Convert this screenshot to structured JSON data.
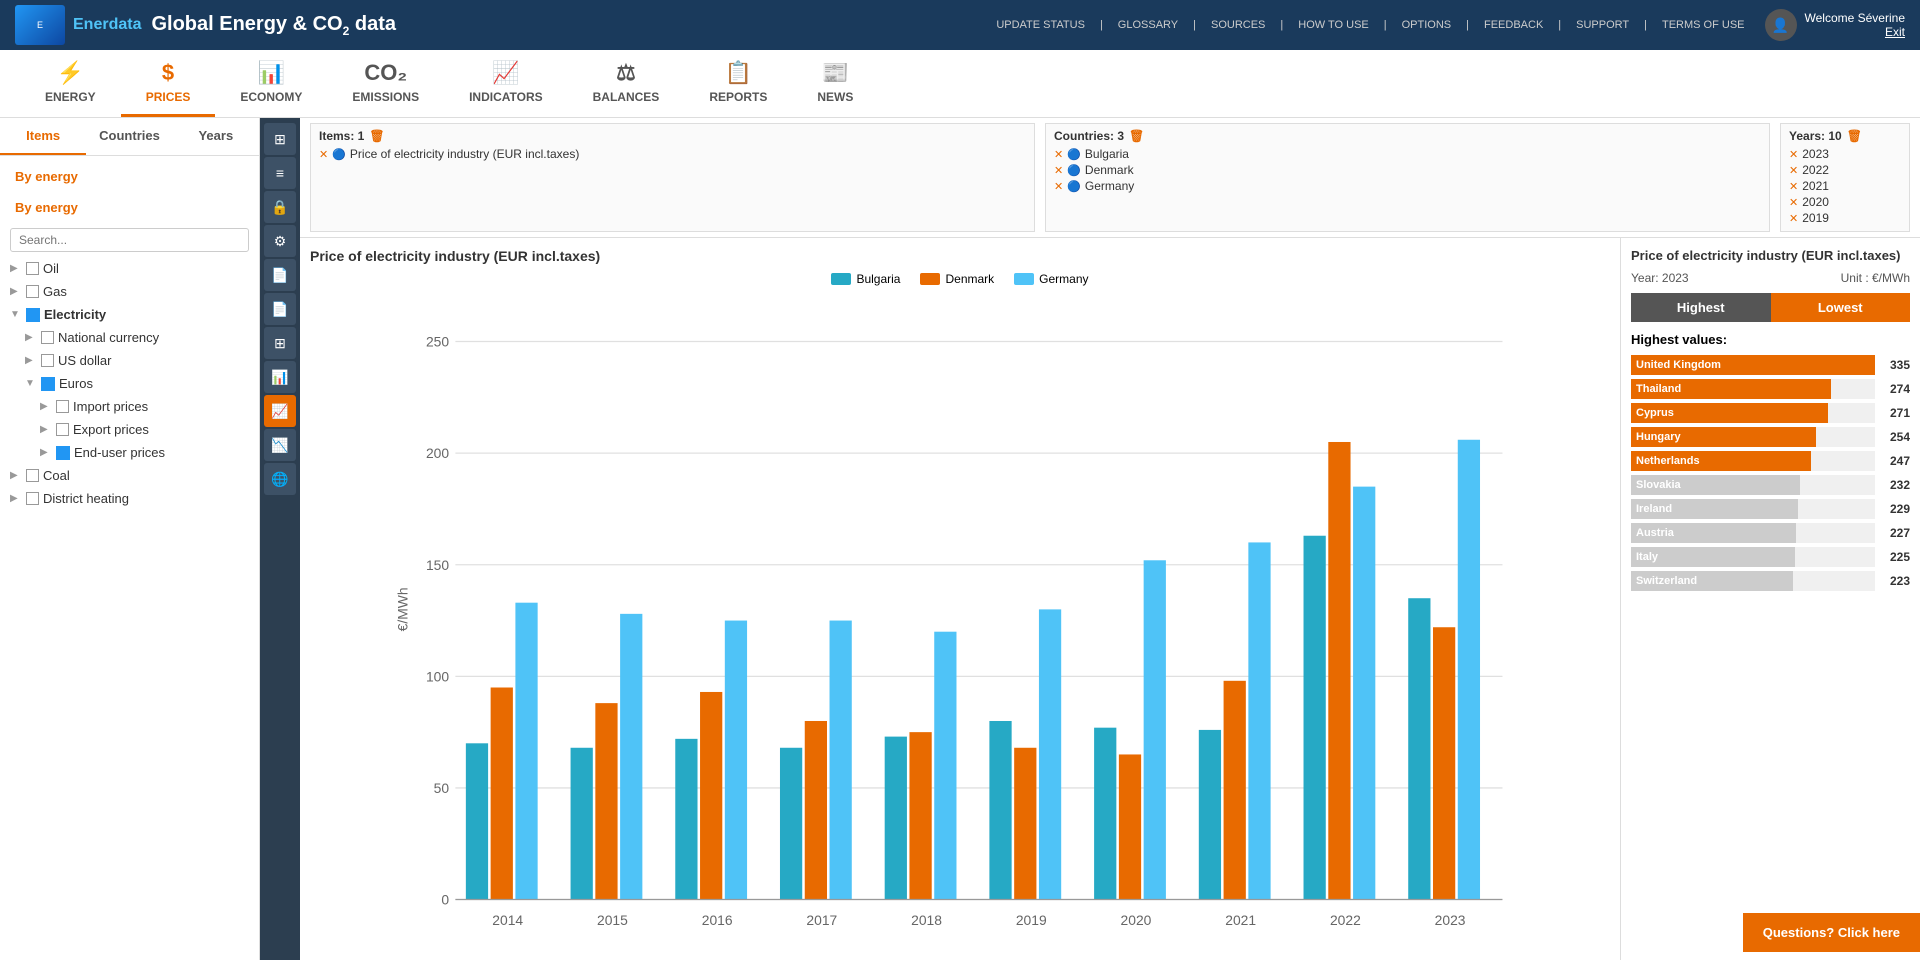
{
  "header": {
    "logo_text": "Enerdata",
    "title": "Global Energy & CO",
    "title_sub": "2",
    "title_suffix": " data",
    "nav_items": [
      "UPDATE STATUS",
      "GLOSSARY",
      "SOURCES",
      "HOW TO USE",
      "OPTIONS",
      "FEEDBACK",
      "SUPPORT",
      "TERMS OF USE"
    ],
    "user_name": "Welcome Séverine",
    "user_action": "Exit"
  },
  "top_nav": {
    "items": [
      {
        "id": "energy",
        "label": "ENERGY",
        "icon": "⚡"
      },
      {
        "id": "prices",
        "label": "PRICES",
        "icon": "$",
        "active": true
      },
      {
        "id": "economy",
        "label": "ECONOMY",
        "icon": "📊"
      },
      {
        "id": "emissions",
        "label": "EMISSIONS",
        "icon": "CO₂"
      },
      {
        "id": "indicators",
        "label": "INDICATORS",
        "icon": "📈"
      },
      {
        "id": "balances",
        "label": "BALANCES",
        "icon": "⚖"
      },
      {
        "id": "reports",
        "label": "REPORTS",
        "icon": "📋"
      },
      {
        "id": "news",
        "label": "NEWS",
        "icon": "📰"
      }
    ]
  },
  "sidebar": {
    "tabs": [
      "Items",
      "Countries",
      "Years"
    ],
    "active_tab": "Items",
    "section_label1": "By energy",
    "section_label2": "By energy",
    "tree": [
      {
        "id": "oil",
        "label": "Oil",
        "level": 0,
        "type": "checkbox"
      },
      {
        "id": "gas",
        "label": "Gas",
        "level": 0,
        "type": "checkbox"
      },
      {
        "id": "electricity",
        "label": "Electricity",
        "level": 0,
        "type": "icon",
        "expanded": true,
        "selected": true
      },
      {
        "id": "national_currency",
        "label": "National currency",
        "level": 1,
        "type": "checkbox"
      },
      {
        "id": "us_dollar",
        "label": "US dollar",
        "level": 1,
        "type": "checkbox"
      },
      {
        "id": "euros",
        "label": "Euros",
        "level": 1,
        "type": "icon",
        "expanded": true
      },
      {
        "id": "import_prices",
        "label": "Import prices",
        "level": 2,
        "type": "checkbox"
      },
      {
        "id": "export_prices",
        "label": "Export prices",
        "level": 2,
        "type": "checkbox"
      },
      {
        "id": "end_user_prices",
        "label": "End-user prices",
        "level": 2,
        "type": "icon"
      },
      {
        "id": "coal",
        "label": "Coal",
        "level": 0,
        "type": "checkbox"
      },
      {
        "id": "district_heating",
        "label": "District heating",
        "level": 0,
        "type": "checkbox"
      }
    ]
  },
  "selection_bar": {
    "items_label": "Items: 1",
    "countries_label": "Countries: 3",
    "years_label": "Years: 10",
    "items": [
      {
        "label": "Price of electricity industry (EUR incl.taxes)"
      }
    ],
    "countries": [
      {
        "label": "Bulgaria"
      },
      {
        "label": "Denmark"
      },
      {
        "label": "Germany"
      }
    ],
    "years": [
      "2023",
      "2022",
      "2021",
      "2020",
      "2019"
    ]
  },
  "chart": {
    "title": "Price of electricity industry (EUR incl.taxes)",
    "y_axis_label": "€/MWh",
    "y_axis_values": [
      0,
      50,
      100,
      150,
      200,
      250
    ],
    "x_axis_values": [
      "2014",
      "2015",
      "2016",
      "2017",
      "2018",
      "2019",
      "2020",
      "2021",
      "2022",
      "2023"
    ],
    "legend": [
      {
        "label": "Bulgaria",
        "color": "#26a9c5"
      },
      {
        "label": "Denmark",
        "color": "#e86a00"
      },
      {
        "label": "Germany",
        "color": "#4fc3f7"
      }
    ],
    "series": {
      "Bulgaria": [
        70,
        68,
        72,
        68,
        73,
        80,
        77,
        76,
        163,
        135
      ],
      "Denmark": [
        95,
        88,
        93,
        80,
        75,
        68,
        65,
        98,
        205,
        122
      ],
      "Germany": [
        133,
        128,
        125,
        125,
        120,
        130,
        152,
        160,
        185,
        206
      ]
    },
    "colors": {
      "Bulgaria": "#26a9c5",
      "Denmark": "#e86a00",
      "Germany": "#4fc3f7"
    }
  },
  "right_panel": {
    "title": "Price of electricity industry (EUR incl.taxes)",
    "year": "Year: 2023",
    "unit": "Unit : €/MWh",
    "highest_label": "Highest",
    "lowest_label": "Lowest",
    "values_label": "Highest values:",
    "rankings": [
      {
        "country": "United Kingdom",
        "value": 335,
        "color": "#e86a00"
      },
      {
        "country": "Thailand",
        "value": 274,
        "color": "#e86a00"
      },
      {
        "country": "Cyprus",
        "value": 271,
        "color": "#e86a00"
      },
      {
        "country": "Hungary",
        "value": 254,
        "color": "#e86a00"
      },
      {
        "country": "Netherlands",
        "value": 247,
        "color": "#e86a00"
      },
      {
        "country": "Slovakia",
        "value": 232,
        "color": "#cccccc"
      },
      {
        "country": "Ireland",
        "value": 229,
        "color": "#cccccc"
      },
      {
        "country": "Austria",
        "value": 227,
        "color": "#cccccc"
      },
      {
        "country": "Italy",
        "value": 225,
        "color": "#cccccc"
      },
      {
        "country": "Switzerland",
        "value": 223,
        "color": "#cccccc"
      }
    ],
    "max_value": 335
  },
  "questions_btn": "Questions? Click here",
  "toolbar": {
    "icons": [
      "⊞",
      "≡",
      "🔒",
      "⚙",
      "📄",
      "📄",
      "⊞",
      "📊",
      "📈",
      "📉",
      "🌐"
    ]
  }
}
